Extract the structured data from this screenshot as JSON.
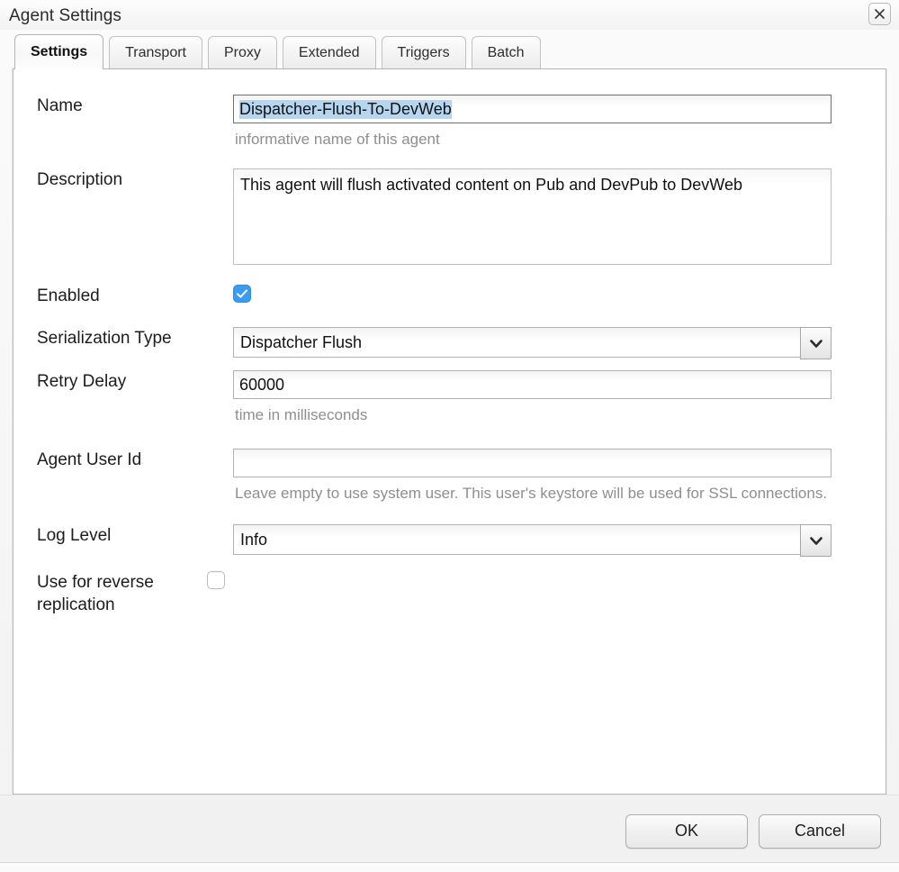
{
  "window": {
    "title": "Agent Settings",
    "close_icon": "close-icon"
  },
  "tabs": [
    {
      "label": "Settings",
      "active": true
    },
    {
      "label": "Transport",
      "active": false
    },
    {
      "label": "Proxy",
      "active": false
    },
    {
      "label": "Extended",
      "active": false
    },
    {
      "label": "Triggers",
      "active": false
    },
    {
      "label": "Batch",
      "active": false
    }
  ],
  "form": {
    "name": {
      "label": "Name",
      "value": "Dispatcher-Flush-To-DevWeb",
      "placeholder": "",
      "help": "informative name of this agent",
      "selected": true
    },
    "description": {
      "label": "Description",
      "value": "This agent will flush activated content on Pub and DevPub to DevWeb",
      "placeholder": ""
    },
    "enabled": {
      "label": "Enabled",
      "checked": true,
      "check_icon": "check-icon"
    },
    "serialization_type": {
      "label": "Serialization Type",
      "value": "Dispatcher Flush",
      "arrow_icon": "chevron-down-icon"
    },
    "retry_delay": {
      "label": "Retry Delay",
      "value": "60000",
      "placeholder": "",
      "help": "time in milliseconds"
    },
    "agent_user_id": {
      "label": "Agent User Id",
      "value": "",
      "placeholder": "",
      "help": "Leave empty to use system user. This user's keystore will be used for SSL connections."
    },
    "log_level": {
      "label": "Log Level",
      "value": "Info",
      "arrow_icon": "chevron-down-icon"
    },
    "reverse_replication": {
      "label": "Use for reverse replication",
      "checked": false
    }
  },
  "footer": {
    "ok_label": "OK",
    "cancel_label": "Cancel"
  },
  "colors": {
    "accent": "#3b9bf0",
    "selection": "#b5d6f0",
    "help_text": "#8e8e8e"
  }
}
